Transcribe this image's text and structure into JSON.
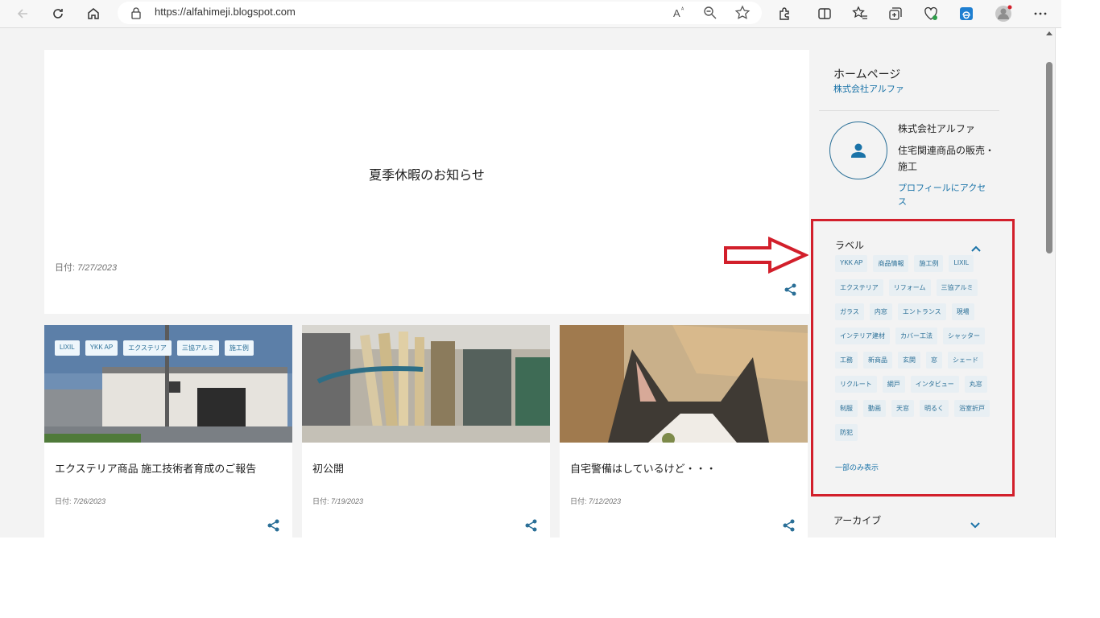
{
  "browser": {
    "url": "https://alfahimeji.blogspot.com",
    "icons": [
      "back-icon",
      "reload-icon",
      "home-icon",
      "lock-icon",
      "read-aloud-icon",
      "zoom-out-icon",
      "favorite-star-icon",
      "extensions-icon",
      "split-screen-icon",
      "favorites-icon",
      "collections-icon",
      "heart-pulse-icon",
      "edge-icon",
      "profile-icon",
      "more-icon"
    ]
  },
  "hero": {
    "title": "夏季休暇のお知らせ",
    "date_label": "日付: ",
    "date": "7/27/2023"
  },
  "posts": [
    {
      "title": "エクステリア商品 施工技術者育成のご報告",
      "date_label": "日付: ",
      "date": "7/26/2023",
      "chips": [
        "LIXIL",
        "YKK AP",
        "エクステリア",
        "三協アルミ",
        "施工例"
      ]
    },
    {
      "title": "初公開",
      "date_label": "日付: ",
      "date": "7/19/2023",
      "chips": []
    },
    {
      "title": "自宅警備はしているけど・・・",
      "date_label": "日付: ",
      "date": "7/12/2023",
      "chips": []
    }
  ],
  "sidebar": {
    "home_title": "ホームページ",
    "home_link": "株式会社アルファ",
    "profile_name": "株式会社アルファ",
    "profile_desc": "住宅関連商品の販売・施工",
    "profile_link": "プロフィールにアクセス",
    "labels_title": "ラベル",
    "labels": [
      "YKK AP",
      "商品情報",
      "施工例",
      "LIXIL",
      "エクステリア",
      "リフォーム",
      "三協アルミ",
      "ガラス",
      "内窓",
      "エントランス",
      "現場",
      "インテリア建材",
      "カバー工法",
      "シャッター",
      "工務",
      "新商品",
      "玄関",
      "窓",
      "シェード",
      "リクルート",
      "網戸",
      "インタビュー",
      "丸窓",
      "制服",
      "動画",
      "天窓",
      "明るく",
      "浴室折戸",
      "防犯"
    ],
    "labels_more": "一部のみ表示",
    "archive_title": "アーカイブ"
  },
  "colors": {
    "accent": "#1a73a8",
    "highlight_box": "#d21f2b",
    "chip_bg": "#e8eff3"
  }
}
